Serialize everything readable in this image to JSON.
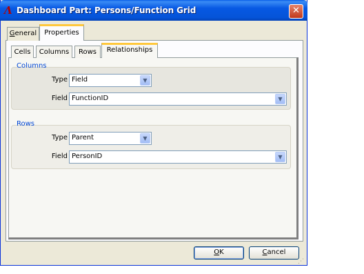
{
  "window": {
    "title": "Dashboard Part: Persons/Function Grid",
    "close_label": "✕"
  },
  "outer_tabs": [
    {
      "label": "General",
      "selected": false
    },
    {
      "label": "Properties",
      "selected": true
    }
  ],
  "inner_tabs": [
    {
      "label": "Cells",
      "selected": false
    },
    {
      "label": "Columns",
      "selected": false
    },
    {
      "label": "Rows",
      "selected": false
    },
    {
      "label": "Relationships",
      "selected": true
    }
  ],
  "columns_group": {
    "label": "Columns",
    "type_label": "Type",
    "type_value": "Field",
    "field_label": "Field",
    "field_value": "FunctionID"
  },
  "rows_group": {
    "label": "Rows",
    "type_label": "Type",
    "type_value": "Parent",
    "field_label": "Field",
    "field_value": "PersonID"
  },
  "buttons": {
    "ok": {
      "label": "OK",
      "mnemonic": "O"
    },
    "cancel": {
      "label": "Cancel",
      "mnemonic": "C"
    }
  },
  "colors": {
    "title_bar": "#0554d8",
    "group_label": "#0046d5",
    "tab_highlight": "#ffc83c",
    "close_button": "#c1391c"
  }
}
